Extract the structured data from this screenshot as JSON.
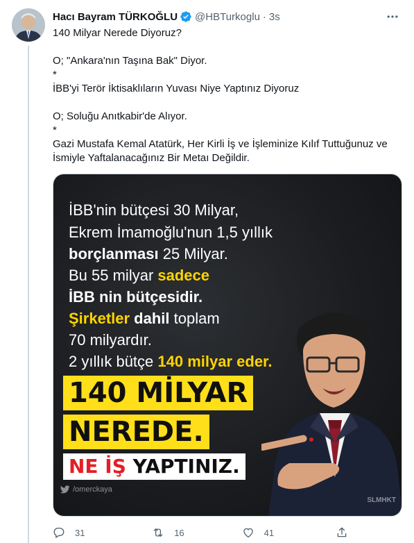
{
  "author": {
    "name": "Hacı Bayram TÜRKOĞLU",
    "handle": "@HBTurkoglu",
    "time": "3s"
  },
  "tweet_lines": [
    "140 Milyar Nerede Diyoruz?",
    "",
    "O; \"Ankara'nın Taşına Bak\" Diyor.",
    "*",
    "İBB'yi Terör İktisaklıların Yuvası Niye Yaptınız Diyoruz",
    "",
    "O; Soluğu Anıtkabir'de Alıyor.",
    "*",
    "Gazi Mustafa Kemal Atatürk, Her Kirli İş ve İşleminize Kılıf Tuttuğunuz ve",
    "İsmiyle Yaftalanacağınız Bir Metaı Değildir."
  ],
  "image": {
    "line1": "İBB'nin  bütçesi 30 Milyar,",
    "line2": "Ekrem İmamoğlu'nun 1,5 yıllık",
    "line3_bold": "borçlanması",
    "line3_rest": " 25 Milyar.",
    "line4_a": "Bu 55 milyar ",
    "line4_yellow": "sadece",
    "line5_bold": "İBB nin bütçesidir.",
    "line6_yellow": "Şirketler",
    "line6_bold": " dahil",
    "line6_rest": " toplam",
    "line7": "70 milyardır.",
    "line8_a": "2 yıllık bütçe ",
    "line8_yellow": "140 milyar eder.",
    "banner1": "140 MİLYAR",
    "banner2": "NEREDE.",
    "banner3_red": "NE İŞ",
    "banner3_dark": " YAPTINIZ.",
    "watermark": "/omerckaya",
    "watermark2": "SLMHKT"
  },
  "actions": {
    "replies": "31",
    "retweets": "16",
    "likes": "41"
  },
  "colors": {
    "verified": "#1d9bf0",
    "text_secondary": "#536471",
    "banner_yellow": "#ffdf1a",
    "accent_red": "#e31f26"
  }
}
